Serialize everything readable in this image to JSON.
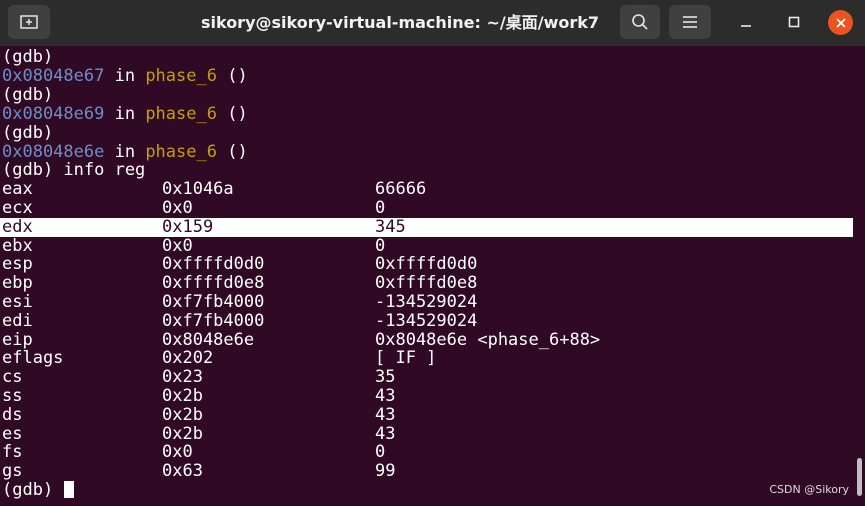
{
  "window": {
    "title": "sikory@sikory-virtual-machine: ~/桌面/work7",
    "new_tab_icon": "new-tab-icon",
    "search_icon": "search-icon",
    "menu_icon": "hamburger-menu-icon",
    "minimize_icon": "minimize-icon",
    "maximize_icon": "maximize-icon",
    "close_icon": "close-icon"
  },
  "terminal": {
    "prompt": "(gdb)",
    "trace": [
      {
        "addr": "0x08048e67",
        "in": " in ",
        "func": "phase_6",
        "args": " ()"
      },
      {
        "addr": "0x08048e69",
        "in": " in ",
        "func": "phase_6",
        "args": " ()"
      },
      {
        "addr": "0x08048e6e",
        "in": " in ",
        "func": "phase_6",
        "args": " ()"
      }
    ],
    "command": "(gdb) info reg",
    "registers": [
      {
        "name": "eax",
        "hex": "0x1046a",
        "value": "66666"
      },
      {
        "name": "ecx",
        "hex": "0x0",
        "value": "0"
      },
      {
        "name": "edx",
        "hex": "0x159",
        "value": "345"
      },
      {
        "name": "ebx",
        "hex": "0x0",
        "value": "0"
      },
      {
        "name": "esp",
        "hex": "0xffffd0d0",
        "value": "0xffffd0d0"
      },
      {
        "name": "ebp",
        "hex": "0xffffd0e8",
        "value": "0xffffd0e8"
      },
      {
        "name": "esi",
        "hex": "0xf7fb4000",
        "value": "-134529024"
      },
      {
        "name": "edi",
        "hex": "0xf7fb4000",
        "value": "-134529024"
      },
      {
        "name": "eip",
        "hex": "0x8048e6e",
        "value": "0x8048e6e <phase_6+88>"
      },
      {
        "name": "eflags",
        "hex": "0x202",
        "value": "[ IF ]"
      },
      {
        "name": "cs",
        "hex": "0x23",
        "value": "35"
      },
      {
        "name": "ss",
        "hex": "0x2b",
        "value": "43"
      },
      {
        "name": "ds",
        "hex": "0x2b",
        "value": "43"
      },
      {
        "name": "es",
        "hex": "0x2b",
        "value": "43"
      },
      {
        "name": "fs",
        "hex": "0x0",
        "value": "0"
      },
      {
        "name": "gs",
        "hex": "0x63",
        "value": "99"
      }
    ],
    "final_prompt": "(gdb) "
  },
  "watermark": "CSDN @Sikory",
  "colors": {
    "background": "#300a24",
    "address": "#6e8ec6",
    "function": "#c4a000",
    "close_button": "#e95420"
  }
}
